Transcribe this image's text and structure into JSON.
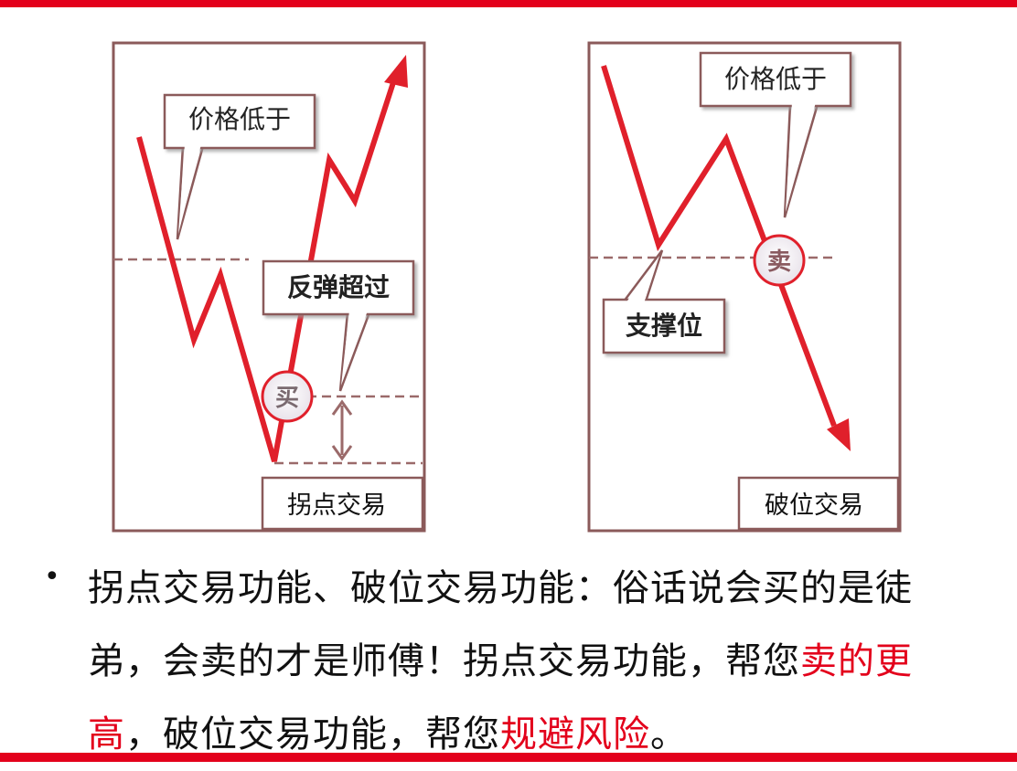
{
  "colors": {
    "accent": "#e3001b",
    "frame": "#8b5a5a",
    "line": "#e0202b"
  },
  "left_panel": {
    "callout_top": "价格低于",
    "callout_mid": "反弹超过",
    "marker": "买",
    "footer": "拐点交易"
  },
  "right_panel": {
    "callout_top": "价格低于",
    "callout_support": "支撑位",
    "marker": "卖",
    "footer": "破位交易"
  },
  "text": {
    "bullet": "•",
    "p1": "拐点交易功能、破位交易功能：俗话说会买的是徒弟，会卖的才是师傅！拐点交易功能，帮您",
    "p1_red": "卖的更高",
    "p2": "，破位交易功能，帮您",
    "p2_red": "规避风险",
    "p3": "。"
  }
}
